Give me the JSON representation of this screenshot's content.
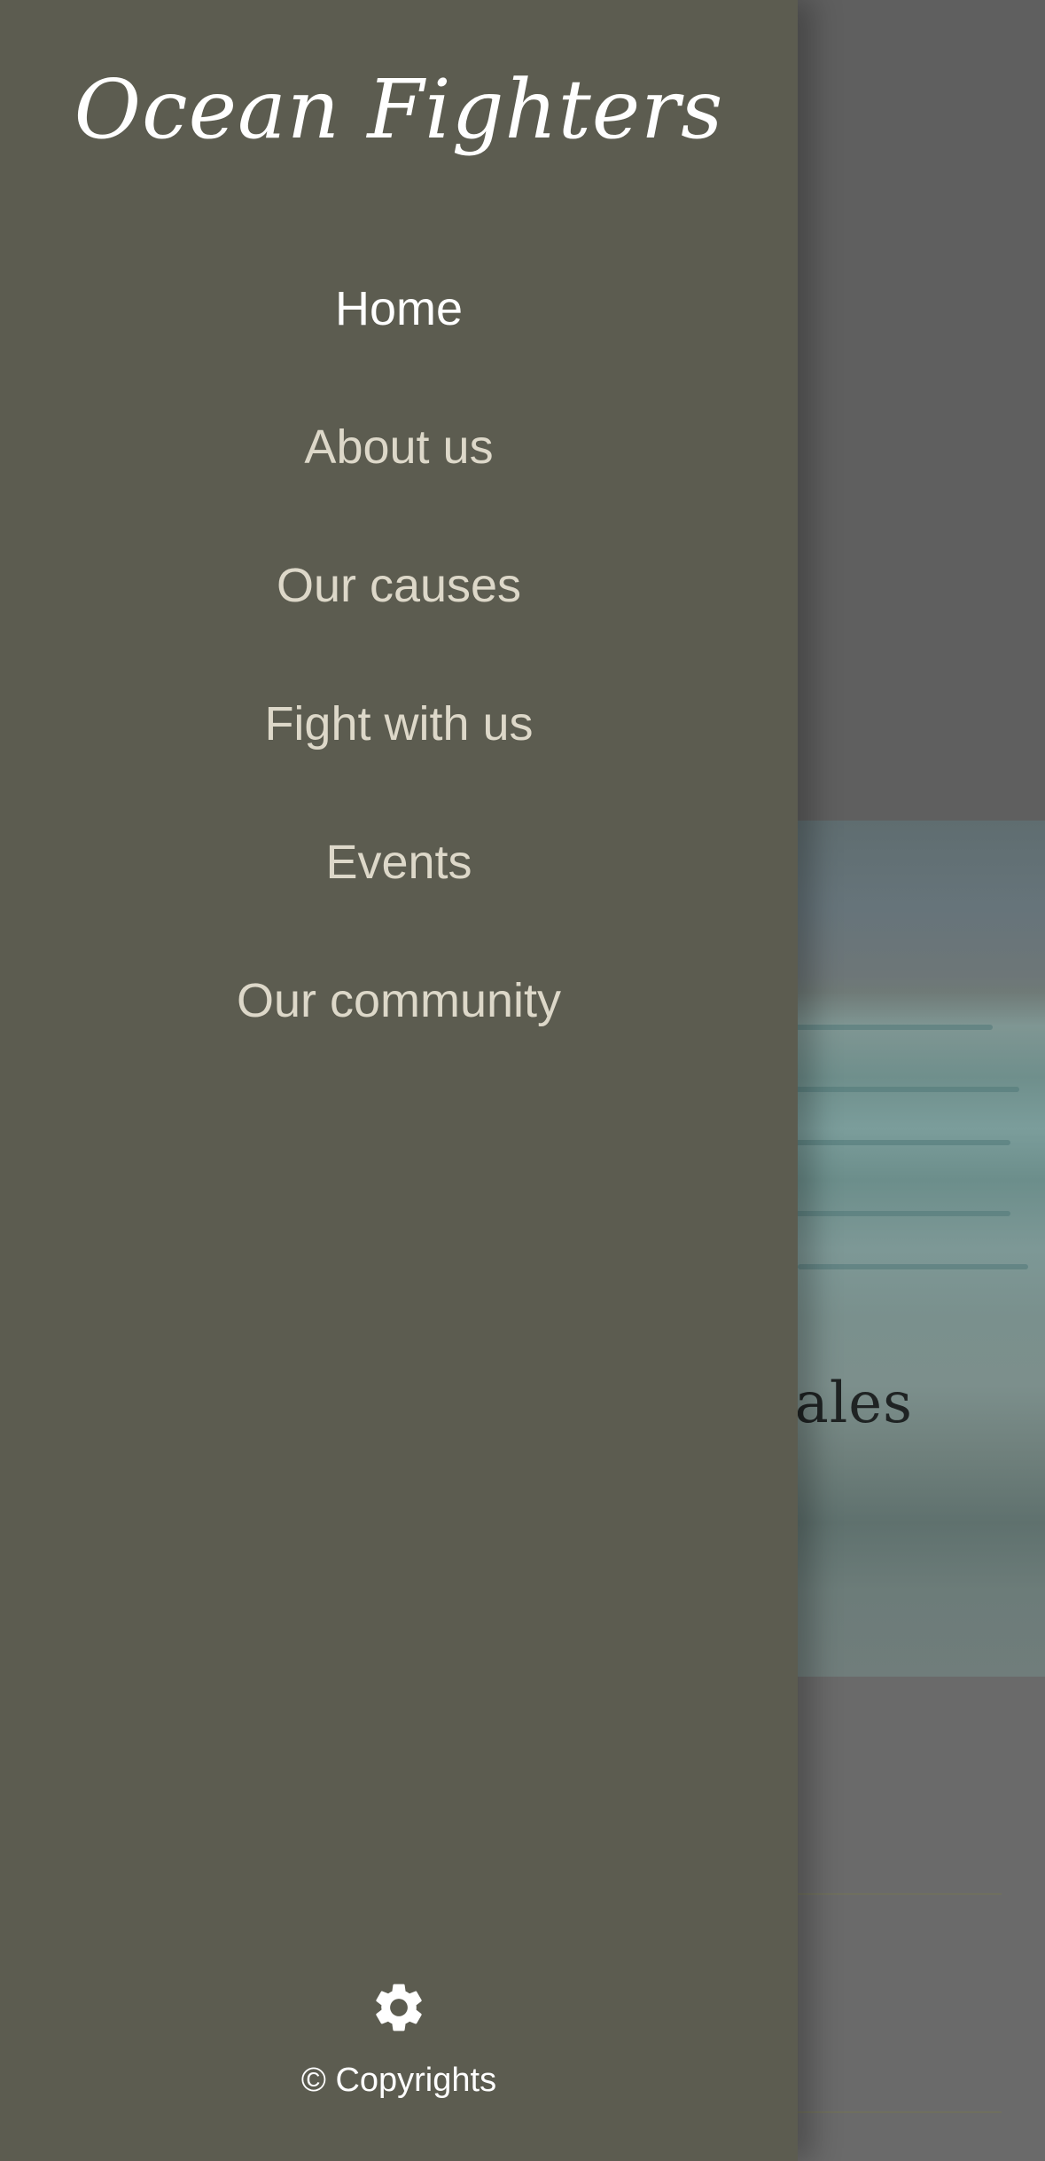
{
  "brand": {
    "title": "Ocean Fighters"
  },
  "nav": {
    "items": [
      {
        "label": "Home",
        "active": true
      },
      {
        "label": "About us",
        "active": false
      },
      {
        "label": "Our causes",
        "active": false
      },
      {
        "label": "Fight with us",
        "active": false
      },
      {
        "label": "Events",
        "active": false
      },
      {
        "label": "Our community",
        "active": false
      }
    ]
  },
  "footer": {
    "settings_icon": "gear-icon",
    "copyright": "© Copyrights"
  },
  "background": {
    "hero_title_visible": "hales"
  },
  "colors": {
    "drawer_bg": "#5c5c50",
    "nav_text": "#ddd8c9",
    "active_text": "#ffffff",
    "overlay": "#686868"
  }
}
